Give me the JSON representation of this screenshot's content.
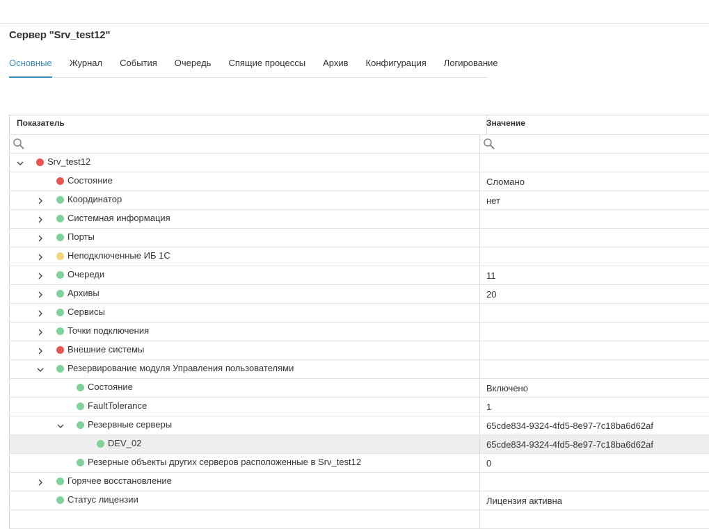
{
  "page": {
    "title": "Сервер \"Srv_test12\"",
    "tabs": [
      {
        "label": "Основные",
        "active": true
      },
      {
        "label": "Журнал"
      },
      {
        "label": "События"
      },
      {
        "label": "Очередь"
      },
      {
        "label": "Спящие процессы"
      },
      {
        "label": "Архив"
      },
      {
        "label": "Конфигурация"
      },
      {
        "label": "Логирование"
      }
    ]
  },
  "table": {
    "columns": {
      "indicator": "Показатель",
      "value": "Значение"
    },
    "search": {
      "indicator_placeholder": "",
      "value_placeholder": ""
    },
    "rows": [
      {
        "name": "Srv_test12",
        "level": 0,
        "toggle": "expanded",
        "status": "red",
        "value": ""
      },
      {
        "name": "Состояние",
        "level": 1,
        "toggle": "none",
        "status": "red",
        "value": "Сломано"
      },
      {
        "name": "Координатор",
        "level": 1,
        "toggle": "collapsed",
        "status": "green",
        "value": "нет"
      },
      {
        "name": "Системная информация",
        "level": 1,
        "toggle": "collapsed",
        "status": "green",
        "value": ""
      },
      {
        "name": "Порты",
        "level": 1,
        "toggle": "collapsed",
        "status": "green",
        "value": ""
      },
      {
        "name": "Неподключенные ИБ 1С",
        "level": 1,
        "toggle": "collapsed",
        "status": "yellow",
        "value": ""
      },
      {
        "name": "Очереди",
        "level": 1,
        "toggle": "collapsed",
        "status": "green",
        "value": "11"
      },
      {
        "name": "Архивы",
        "level": 1,
        "toggle": "collapsed",
        "status": "green",
        "value": "20"
      },
      {
        "name": "Сервисы",
        "level": 1,
        "toggle": "collapsed",
        "status": "green",
        "value": ""
      },
      {
        "name": "Точки подключения",
        "level": 1,
        "toggle": "collapsed",
        "status": "green",
        "value": ""
      },
      {
        "name": "Внешние системы",
        "level": 1,
        "toggle": "collapsed",
        "status": "red",
        "value": ""
      },
      {
        "name": "Резервирование модуля Управления пользователями",
        "level": 1,
        "toggle": "expanded",
        "status": "green",
        "value": ""
      },
      {
        "name": "Состояние",
        "level": 2,
        "toggle": "none",
        "status": "green",
        "value": "Включено"
      },
      {
        "name": "FaultTolerance",
        "level": 2,
        "toggle": "none",
        "status": "green",
        "value": "1"
      },
      {
        "name": "Резервные серверы",
        "level": 2,
        "toggle": "expanded",
        "status": "green",
        "value": "65cde834-9324-4fd5-8e97-7c18ba6d62af"
      },
      {
        "name": "DEV_02",
        "level": 3,
        "toggle": "none",
        "status": "green",
        "value": "65cde834-9324-4fd5-8e97-7c18ba6d62af",
        "selected": true
      },
      {
        "name": "Резерные объекты других серверов расположенные в Srv_test12",
        "level": 2,
        "toggle": "none",
        "status": "green",
        "value": "0"
      },
      {
        "name": "Горячее восстановление",
        "level": 1,
        "toggle": "collapsed",
        "status": "green",
        "value": ""
      },
      {
        "name": "Статус лицензии",
        "level": 1,
        "toggle": "none",
        "status": "green",
        "value": "Лицензия активна"
      },
      {
        "name": "",
        "level": 0,
        "toggle": "none",
        "status": "",
        "value": ""
      }
    ]
  },
  "colors": {
    "accent": "#3a8bb8",
    "status_red": "#e85454",
    "status_green": "#7fd39a",
    "status_yellow": "#f1d67c"
  },
  "icons": {
    "search": "search-icon",
    "expanded": "chevron-down-icon",
    "collapsed": "chevron-right-icon"
  }
}
